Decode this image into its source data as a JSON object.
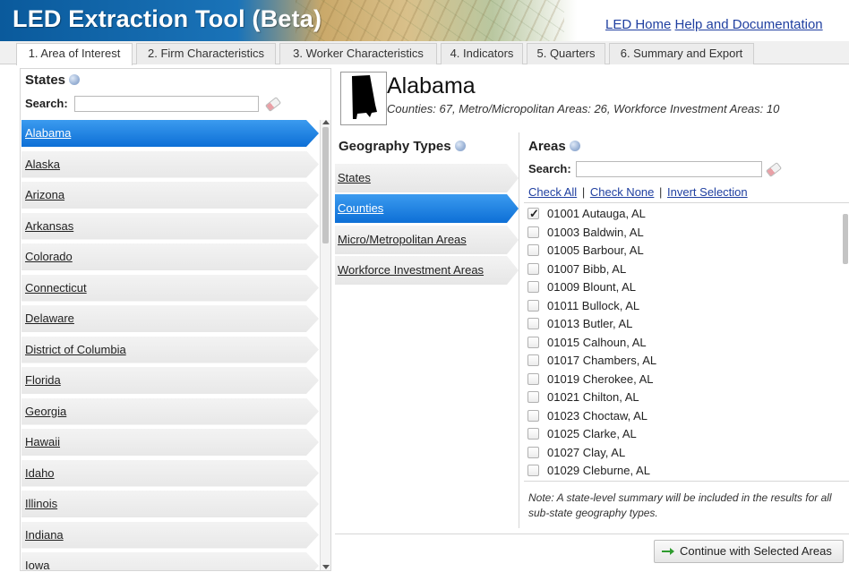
{
  "app": {
    "title": "LED Extraction Tool (Beta)"
  },
  "header_links": [
    {
      "label": "LED Home"
    },
    {
      "label": "Help and Documentation"
    }
  ],
  "tabs": [
    {
      "label": "1. Area of Interest",
      "active": true
    },
    {
      "label": "2. Firm Characteristics",
      "active": false
    },
    {
      "label": "3. Worker Characteristics",
      "active": false
    },
    {
      "label": "4. Indicators",
      "active": false
    },
    {
      "label": "5. Quarters",
      "active": false
    },
    {
      "label": "6. Summary and Export",
      "active": false
    }
  ],
  "states_panel": {
    "title": "States",
    "search_label": "Search:",
    "search_value": "",
    "items": [
      {
        "label": "Alabama",
        "selected": true
      },
      {
        "label": "Alaska"
      },
      {
        "label": "Arizona"
      },
      {
        "label": "Arkansas"
      },
      {
        "label": "Colorado"
      },
      {
        "label": "Connecticut"
      },
      {
        "label": "Delaware"
      },
      {
        "label": "District of Columbia"
      },
      {
        "label": "Florida"
      },
      {
        "label": "Georgia"
      },
      {
        "label": "Hawaii"
      },
      {
        "label": "Idaho"
      },
      {
        "label": "Illinois"
      },
      {
        "label": "Indiana"
      },
      {
        "label": "Iowa"
      }
    ]
  },
  "state_info": {
    "name": "Alabama",
    "stats": "Counties: 67, Metro/Micropolitan Areas: 26, Workforce Investment Areas: 10"
  },
  "geography_types": {
    "title": "Geography Types",
    "items": [
      {
        "label": "States"
      },
      {
        "label": "Counties",
        "selected": true
      },
      {
        "label": "Micro/Metropolitan Areas"
      },
      {
        "label": "Workforce Investment Areas"
      }
    ]
  },
  "areas": {
    "title": "Areas",
    "search_label": "Search:",
    "search_value": "",
    "actions": {
      "check_all": "Check All",
      "separator": "|",
      "check_none": "Check None",
      "invert": "Invert Selection"
    },
    "items": [
      {
        "label": "01001 Autauga, AL",
        "checked": true
      },
      {
        "label": "01003 Baldwin, AL",
        "checked": false
      },
      {
        "label": "01005 Barbour, AL",
        "checked": false
      },
      {
        "label": "01007 Bibb, AL",
        "checked": false
      },
      {
        "label": "01009 Blount, AL",
        "checked": false
      },
      {
        "label": "01011 Bullock, AL",
        "checked": false
      },
      {
        "label": "01013 Butler, AL",
        "checked": false
      },
      {
        "label": "01015 Calhoun, AL",
        "checked": false
      },
      {
        "label": "01017 Chambers, AL",
        "checked": false
      },
      {
        "label": "01019 Cherokee, AL",
        "checked": false
      },
      {
        "label": "01021 Chilton, AL",
        "checked": false
      },
      {
        "label": "01023 Choctaw, AL",
        "checked": false
      },
      {
        "label": "01025 Clarke, AL",
        "checked": false
      },
      {
        "label": "01027 Clay, AL",
        "checked": false
      },
      {
        "label": "01029 Cleburne, AL",
        "checked": false
      }
    ],
    "note": "Note: A state-level summary will be included in the results for all sub-state geography types."
  },
  "footer": {
    "continue_label": "Continue with Selected Areas"
  },
  "colors": {
    "selected_blue": "#0d6fd6",
    "link_blue": "#1f3fa0",
    "header_blue": "#0a5a9c",
    "arrow_green": "#2e9b2e"
  },
  "icons": {
    "help": "help-icon",
    "eraser": "eraser-icon",
    "continue": "arrow-right-icon"
  }
}
